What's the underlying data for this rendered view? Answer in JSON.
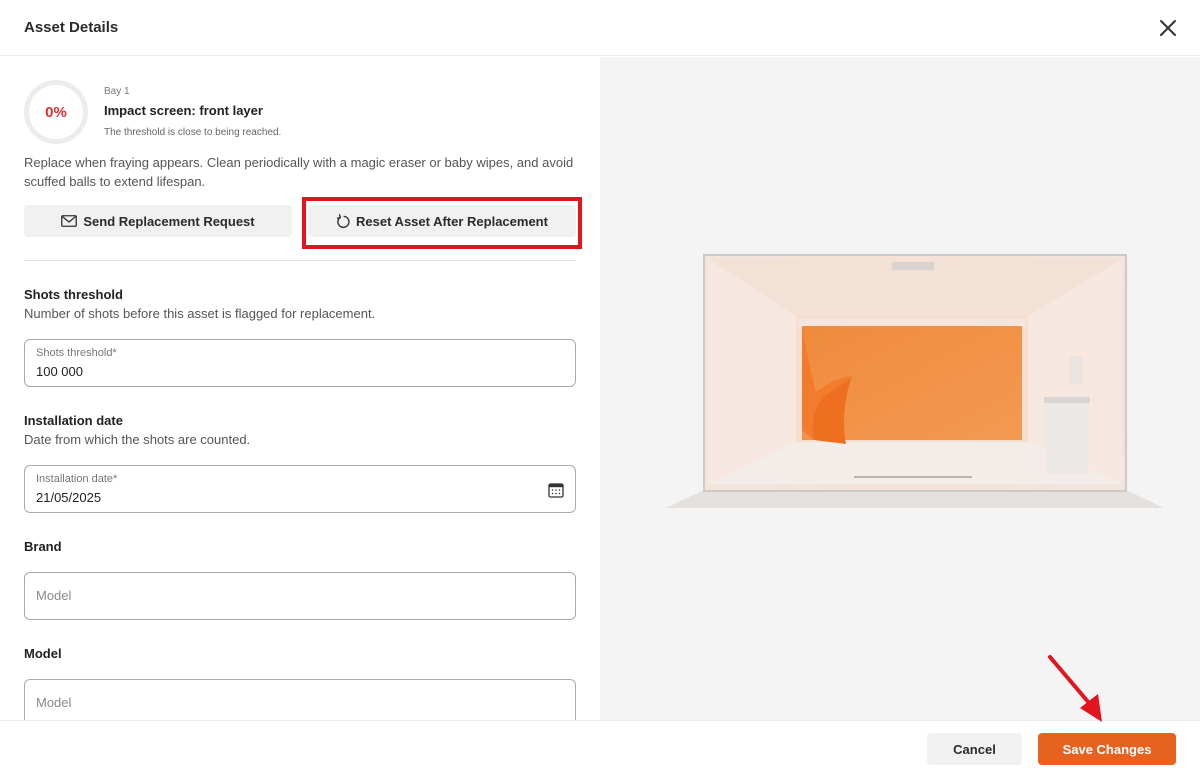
{
  "header": {
    "title": "Asset Details"
  },
  "asset": {
    "progress": "0%",
    "bay": "Bay 1",
    "name": "Impact screen: front layer",
    "status": "The threshold is close to being reached.",
    "description": "Replace when fraying appears. Clean periodically with a magic eraser or baby wipes, and avoid scuffed balls to extend lifespan."
  },
  "actions": {
    "send_label": "Send Replacement Request",
    "reset_label": "Reset Asset After Replacement"
  },
  "shots": {
    "title": "Shots threshold",
    "subtitle": "Number of shots before this asset is flagged for replacement.",
    "label": "Shots threshold*",
    "value": "100 000"
  },
  "installation": {
    "title": "Installation date",
    "subtitle": "Date from which the shots are counted.",
    "label": "Installation date*",
    "value": "21/05/2025"
  },
  "brand": {
    "title": "Brand",
    "placeholder": "Model"
  },
  "model": {
    "title": "Model",
    "placeholder": "Model"
  },
  "footer": {
    "cancel_label": "Cancel",
    "save_label": "Save Changes"
  },
  "colors": {
    "accent": "#e8621f",
    "danger": "#e0302f",
    "highlight": "#e3141e"
  },
  "icons": [
    "close-icon",
    "envelope-icon",
    "reset-icon",
    "calendar-icon"
  ]
}
